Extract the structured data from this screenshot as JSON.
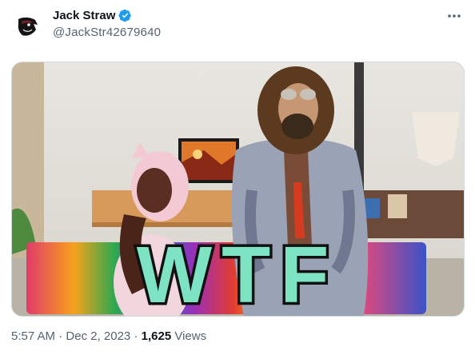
{
  "author": {
    "display_name": "Jack Straw",
    "handle": "@JackStr42679640",
    "verified": true
  },
  "icons": {
    "avatar": "raven-logo-avatar",
    "verified": "verified-badge-icon",
    "more": "more-options-icon"
  },
  "media": {
    "overlay_text": "WTF"
  },
  "footer": {
    "time": "5:57 AM",
    "separator": "·",
    "date": "Dec 2, 2023",
    "views_count": "1,625",
    "views_label": "Views"
  },
  "colors": {
    "verified": "#1d9bf0",
    "secondary_text": "#536471",
    "primary_text": "#0f1419",
    "overlay_text": "#7de3c3"
  }
}
